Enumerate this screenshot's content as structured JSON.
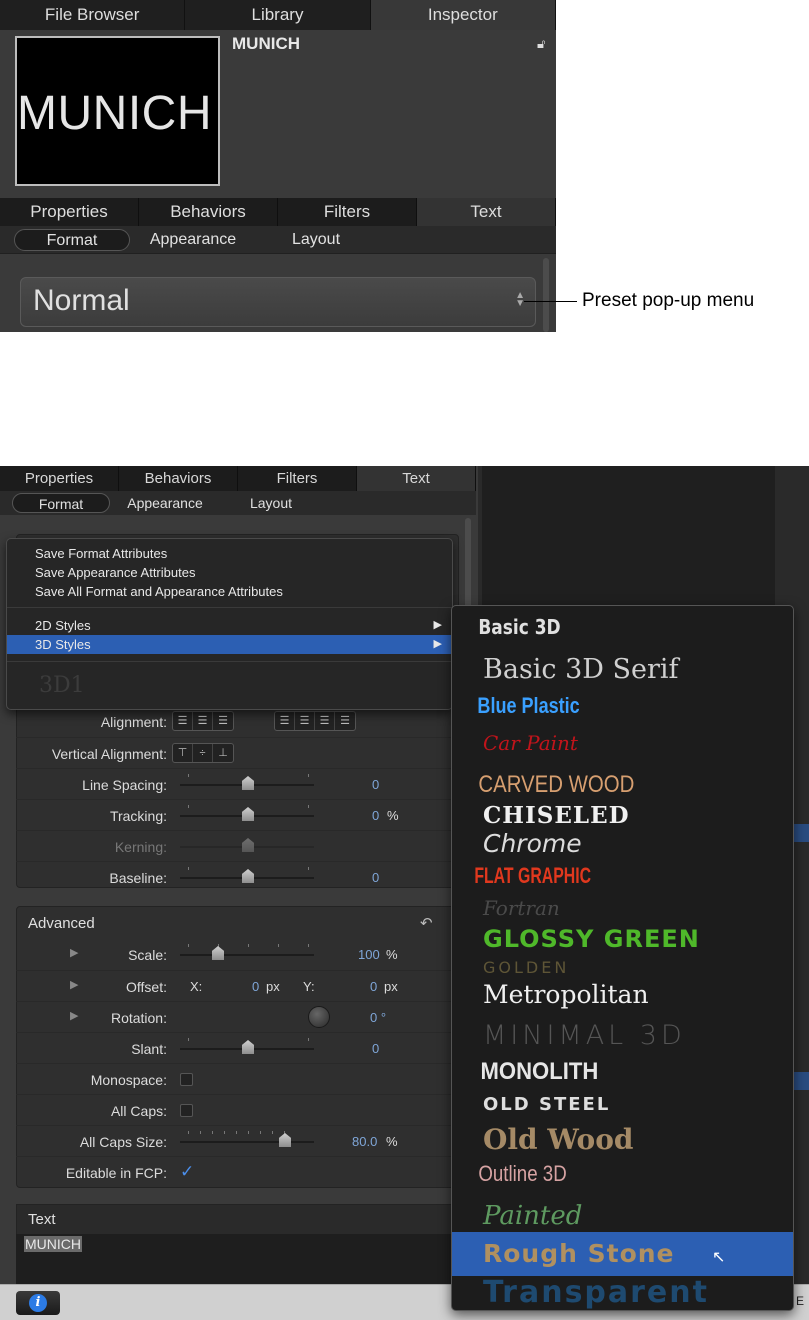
{
  "top": {
    "tabs": [
      "File Browser",
      "Library",
      "Inspector"
    ],
    "preview_text": "MUNICH",
    "item_name": "MUNICH",
    "lock_icon": "lock-icon",
    "tabs2": [
      "Properties",
      "Behaviors",
      "Filters",
      "Text"
    ],
    "subtabs": [
      "Format",
      "Appearance",
      "Layout"
    ],
    "preset_value": "Normal",
    "callout": "Preset pop-up menu"
  },
  "bottom": {
    "tabs": [
      "Properties",
      "Behaviors",
      "Filters",
      "Text"
    ],
    "subtabs": [
      "Format",
      "Appearance",
      "Layout"
    ],
    "menu": {
      "items": [
        "Save Format Attributes",
        "Save Appearance Attributes",
        "Save All Format and Appearance Attributes"
      ],
      "styles_2d": "2D Styles",
      "styles_3d": "3D Styles",
      "ghost": "3D1"
    },
    "submenu": [
      "Basic 3D",
      "Basic 3D Serif",
      "Blue  Plastic",
      "Car Paint",
      "CARVED WOOD",
      "CHISELED",
      "Chrome",
      "FLAT GRAPHIC",
      "Fortran",
      "GLOSSY GREEN",
      "GOLDEN",
      "Metropolitan",
      "MINIMAL 3D",
      "MONOLITH",
      "OLD STEEL",
      "Old Wood",
      "Outline 3D",
      "Painted",
      "Rough Stone",
      "Transparent"
    ],
    "format_rows": {
      "alignment": "Alignment:",
      "vertical_alignment": "Vertical Alignment:",
      "line_spacing": "Line Spacing:",
      "line_spacing_val": "0",
      "tracking": "Tracking:",
      "tracking_val": "0",
      "tracking_unit": "%",
      "kerning": "Kerning:",
      "baseline": "Baseline:",
      "baseline_val": "0"
    },
    "advanced": {
      "title": "Advanced",
      "scale": "Scale:",
      "scale_val": "100",
      "scale_unit": "%",
      "offset": "Offset:",
      "offset_x_lbl": "X:",
      "offset_x": "0",
      "offset_x_unit": "px",
      "offset_y_lbl": "Y:",
      "offset_y": "0",
      "offset_y_unit": "px",
      "rotation": "Rotation:",
      "rotation_val": "0 °",
      "slant": "Slant:",
      "slant_val": "0",
      "monospace": "Monospace:",
      "all_caps": "All Caps:",
      "all_caps_size": "All Caps Size:",
      "all_caps_size_val": "80.0",
      "all_caps_size_unit": "%",
      "editable": "Editable in FCP:",
      "editable_checked": true
    },
    "text_section": {
      "title": "Text",
      "value": "MUNICH"
    },
    "edge_letter": "E",
    "accent": "#2c5fb3"
  }
}
